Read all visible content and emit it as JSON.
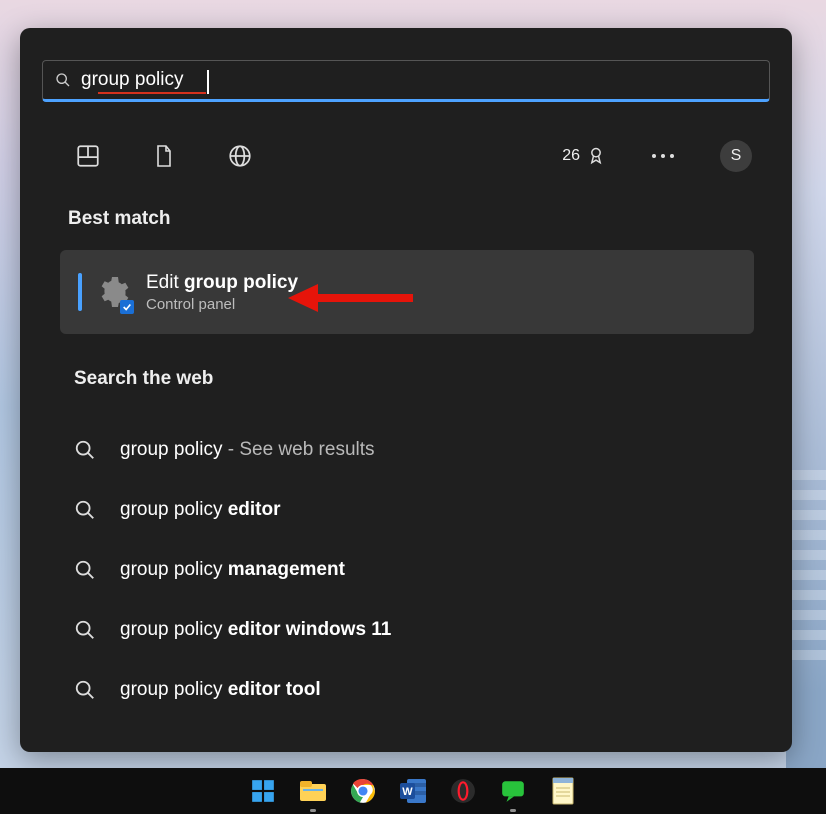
{
  "search": {
    "query": "group policy"
  },
  "filters": {
    "points": "26"
  },
  "avatar_letter": "S",
  "best_match_header": "Best match",
  "best_match": {
    "title_prefix": "Edit ",
    "title_bold": "group policy",
    "subtitle": "Control panel"
  },
  "web_header": "Search the web",
  "web_results": [
    {
      "prefix": "group policy",
      "bold": "",
      "suffix": " - See web results"
    },
    {
      "prefix": "group policy ",
      "bold": "editor",
      "suffix": ""
    },
    {
      "prefix": "group policy ",
      "bold": "management",
      "suffix": ""
    },
    {
      "prefix": "group policy ",
      "bold": "editor windows 11",
      "suffix": ""
    },
    {
      "prefix": "group policy ",
      "bold": "editor tool",
      "suffix": ""
    }
  ],
  "taskbar": [
    "start",
    "explorer",
    "chrome",
    "word",
    "opera",
    "assistant",
    "notepad"
  ]
}
